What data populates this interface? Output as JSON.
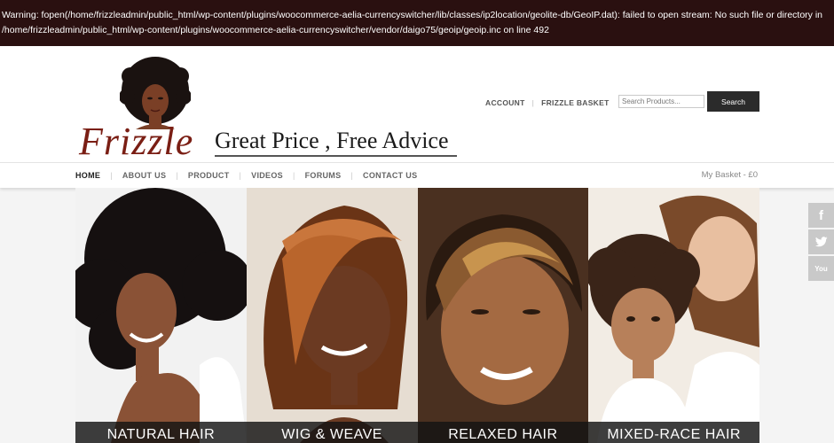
{
  "warning": {
    "line1": "Warning: fopen(/home/frizzleadmin/public_html/wp-content/plugins/woocommerce-aelia-currencyswitcher/lib/classes/ip2location/geolite-db/GeoIP.dat): failed to open stream: No such file or directory in",
    "line2": "/home/frizzleadmin/public_html/wp-content/plugins/woocommerce-aelia-currencyswitcher/vendor/daigo75/geoip/geoip.inc on line 492"
  },
  "logo": {
    "wordmark": "Frizzle",
    "tagline": "Great Price , Free Advice",
    "brand_color": "#7a1e14"
  },
  "top_links": {
    "account": "ACCOUNT",
    "basket": "FRIZZLE BASKET"
  },
  "search": {
    "placeholder": "Search Products...",
    "button": "Search"
  },
  "nav": {
    "items": [
      "HOME",
      "ABOUT US",
      "PRODUCT",
      "VIDEOS",
      "FORUMS",
      "CONTACT US"
    ],
    "basket": "My Basket - £0"
  },
  "panels": [
    {
      "label": "NATURAL HAIR"
    },
    {
      "label": "WIG & WEAVE"
    },
    {
      "label": "RELAXED HAIR"
    },
    {
      "label": "MIXED-RACE HAIR"
    }
  ],
  "social": {
    "facebook": "f",
    "twitter_icon": "twitter-icon",
    "youtube": "You"
  },
  "colors": {
    "warning_bg": "#2a1010",
    "button_bg": "#2b2b2b",
    "social_bg": "#c9c9c9"
  }
}
